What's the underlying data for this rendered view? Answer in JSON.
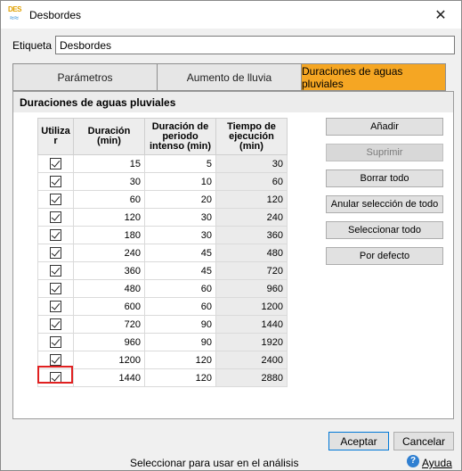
{
  "window": {
    "title": "Desbordes",
    "icon_top": "DES",
    "icon_bottom": "≈≈",
    "close_glyph": "✕"
  },
  "etiqueta": {
    "label": "Etiqueta",
    "value": "Desbordes"
  },
  "tabs": [
    {
      "label": "Parámetros",
      "active": false
    },
    {
      "label": "Aumento de lluvia",
      "active": false
    },
    {
      "label": "Duraciones de aguas pluviales",
      "active": true
    }
  ],
  "panel": {
    "header": "Duraciones de aguas pluviales"
  },
  "table": {
    "headers": [
      "Utiliza r",
      "Duración (min)",
      "Duración de periodo intenso (min)",
      "Tiempo de ejecución (min)"
    ],
    "rows": [
      {
        "use": true,
        "duracion": "15",
        "intenso": "5",
        "ejecucion": "30"
      },
      {
        "use": true,
        "duracion": "30",
        "intenso": "10",
        "ejecucion": "60"
      },
      {
        "use": true,
        "duracion": "60",
        "intenso": "20",
        "ejecucion": "120"
      },
      {
        "use": true,
        "duracion": "120",
        "intenso": "30",
        "ejecucion": "240"
      },
      {
        "use": true,
        "duracion": "180",
        "intenso": "30",
        "ejecucion": "360"
      },
      {
        "use": true,
        "duracion": "240",
        "intenso": "45",
        "ejecucion": "480"
      },
      {
        "use": true,
        "duracion": "360",
        "intenso": "45",
        "ejecucion": "720"
      },
      {
        "use": true,
        "duracion": "480",
        "intenso": "60",
        "ejecucion": "960"
      },
      {
        "use": true,
        "duracion": "600",
        "intenso": "60",
        "ejecucion": "1200"
      },
      {
        "use": true,
        "duracion": "720",
        "intenso": "90",
        "ejecucion": "1440"
      },
      {
        "use": true,
        "duracion": "960",
        "intenso": "90",
        "ejecucion": "1920"
      },
      {
        "use": true,
        "duracion": "1200",
        "intenso": "120",
        "ejecucion": "2400"
      },
      {
        "use": true,
        "duracion": "1440",
        "intenso": "120",
        "ejecucion": "2880"
      }
    ]
  },
  "side_buttons": {
    "add": "Añadir",
    "delete": "Suprimir",
    "clear_all": "Borrar todo",
    "deselect_all": "Anular selección de todo",
    "select_all": "Seleccionar todo",
    "default": "Por defecto"
  },
  "footer": {
    "accept": "Aceptar",
    "cancel": "Cancelar",
    "status": "Seleccionar para usar en el análisis",
    "help_glyph": "?",
    "help": "Ayuda"
  },
  "colors": {
    "active_tab": "#f5a623",
    "focus_border": "#e02020",
    "help_icon": "#2f7fd1"
  }
}
